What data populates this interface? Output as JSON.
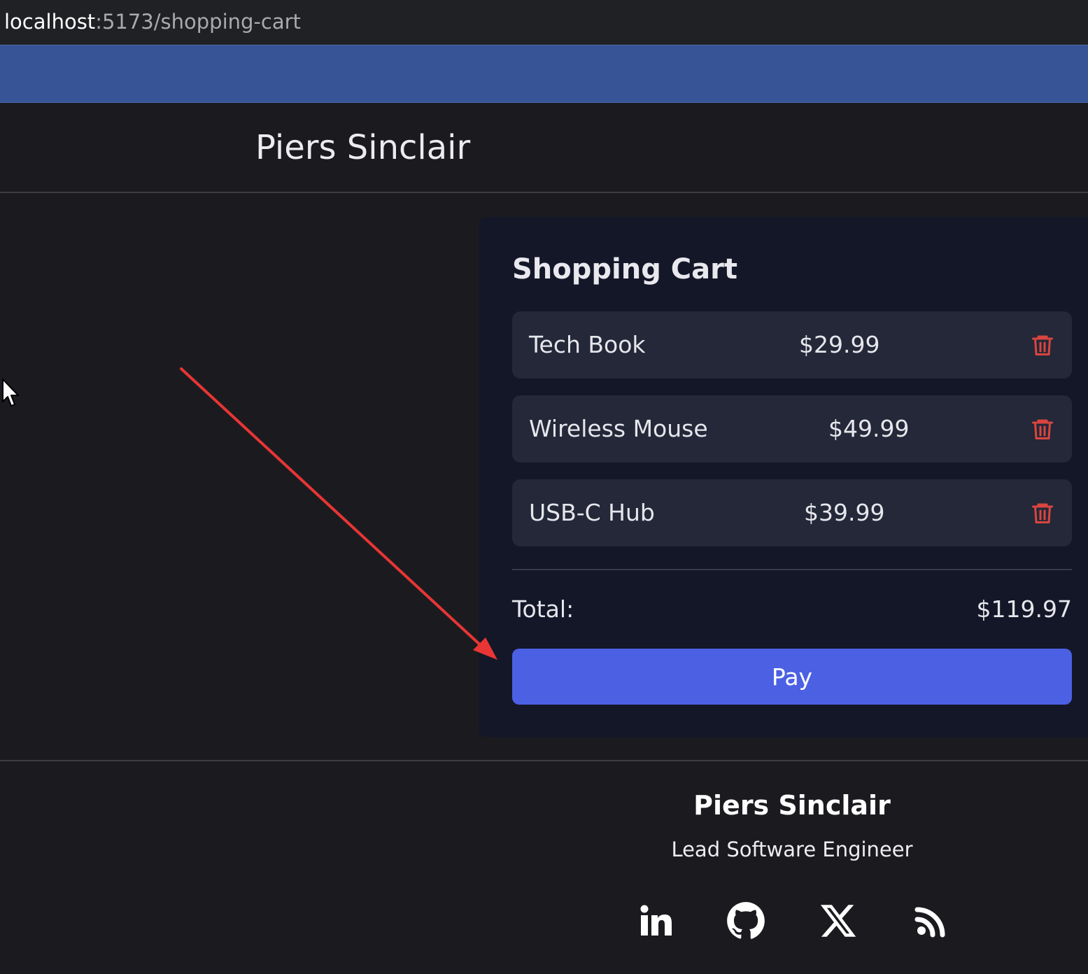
{
  "browser": {
    "url_host": "localhost",
    "url_path": ":5173/shopping-cart"
  },
  "header": {
    "site_title": "Piers Sinclair"
  },
  "cart": {
    "heading": "Shopping Cart",
    "items": [
      {
        "name": "Tech Book",
        "price": "$29.99",
        "remove_icon": "trash-icon"
      },
      {
        "name": "Wireless Mouse",
        "price": "$49.99",
        "remove_icon": "trash-icon"
      },
      {
        "name": "USB-C Hub",
        "price": "$39.99",
        "remove_icon": "trash-icon"
      }
    ],
    "total_label": "Total:",
    "total_value": "$119.97",
    "pay_label": "Pay"
  },
  "footer": {
    "name": "Piers Sinclair",
    "role": "Lead Software Engineer",
    "social_icons": [
      "linkedin-icon",
      "github-icon",
      "x-icon",
      "rss-icon"
    ]
  },
  "colors": {
    "page_background": "#1b1b1f",
    "banner": "#365496",
    "card_background": "#141727",
    "item_background": "#242838",
    "pay_button": "#4c60e4",
    "trash_icon": "#d9453f",
    "annotation_arrow": "#e83535"
  }
}
